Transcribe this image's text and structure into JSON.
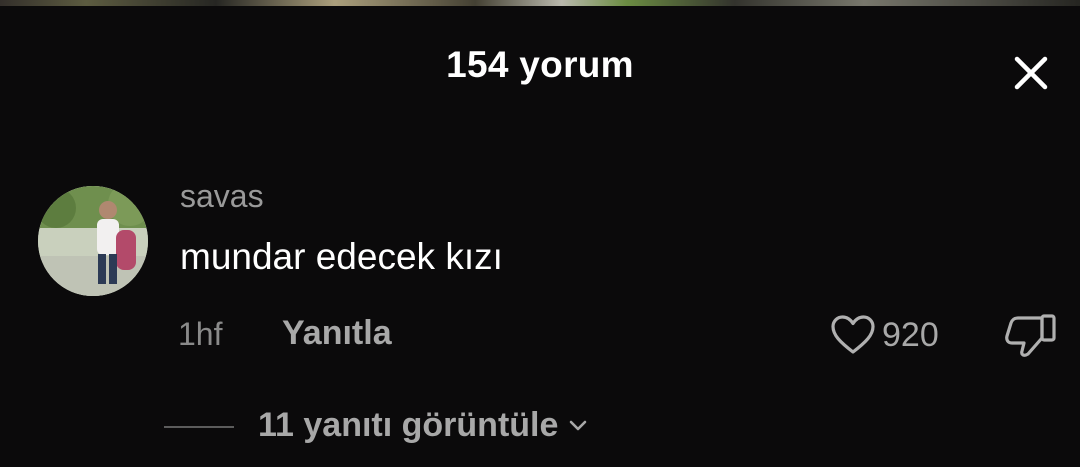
{
  "header": {
    "title": "154 yorum",
    "close_icon": "close-icon"
  },
  "comment": {
    "avatar_icon": "user-avatar",
    "username": "savas",
    "text": "mundar edecek kızı",
    "time": "1hf",
    "reply_label": "Yanıtla",
    "like_icon": "heart-outline-icon",
    "like_count": "920",
    "dislike_icon": "thumbs-down-outline-icon",
    "view_replies_label": "11 yanıtı görüntüle",
    "view_replies_icon": "chevron-down-icon"
  },
  "colors": {
    "background": "#0b0a0b",
    "primary_text": "#ffffff",
    "secondary_text": "#a8a8a8",
    "muted_text": "#8a8a8a"
  }
}
